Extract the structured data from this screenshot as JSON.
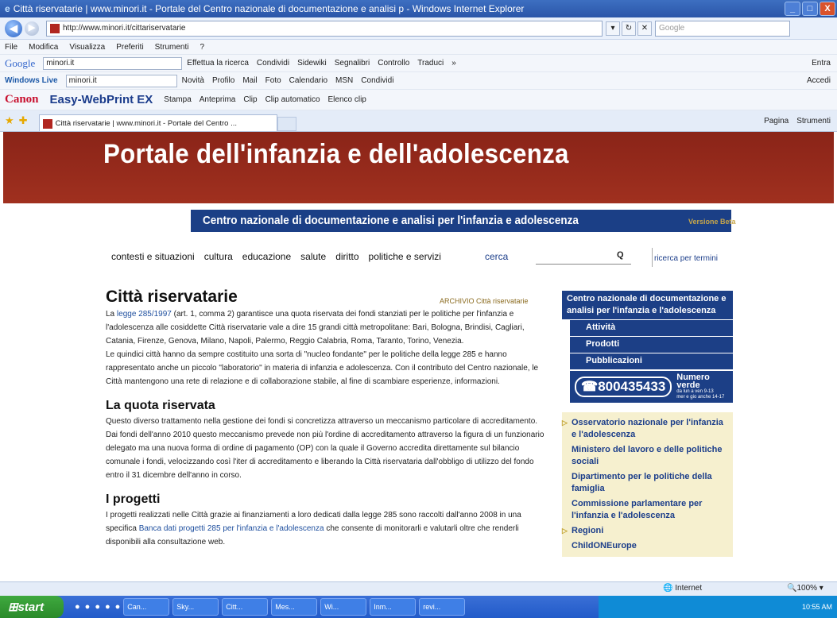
{
  "window": {
    "title": "Città riservatarie | www.minori.it - Portale del Centro nazionale di documentazione e analisi p - Windows Internet Explorer",
    "min": "_",
    "max": "□",
    "close": "X"
  },
  "address": {
    "url": "http://www.minori.it/cittariservatarie",
    "search_placeholder": "Google"
  },
  "menu": [
    "File",
    "Modifica",
    "Visualizza",
    "Preferiti",
    "Strumenti",
    "?"
  ],
  "google_bar": {
    "logo": "Google",
    "query": "minori.it",
    "items": [
      "Effettua la ricerca",
      "Condividi",
      "Sidewiki",
      "Segnalibri",
      "Controllo",
      "Traduci",
      "»"
    ],
    "right": "Entra"
  },
  "live_bar": {
    "logo": "Windows Live",
    "query": "minori.it",
    "items": [
      "Novità",
      "Profilo",
      "Mail",
      "Foto",
      "Calendario",
      "MSN",
      "Condividi"
    ],
    "right": "Accedi"
  },
  "canon_bar": {
    "logo": "Canon",
    "product": "Easy-WebPrint EX",
    "items": [
      "Stampa",
      "Anteprima",
      "Clip",
      "Clip automatico",
      "Elenco clip"
    ]
  },
  "tabs": {
    "active": "Città riservatarie | www.minori.it - Portale del Centro ...",
    "right": [
      "Pagina",
      "Strumenti"
    ]
  },
  "site": {
    "title": "Portale dell'infanzia e dell'adolescenza",
    "subtitle": "Centro nazionale di documentazione e analisi per l'infanzia e adolescenza",
    "version": "Versione Beta",
    "nav": [
      "contesti e situazioni",
      "cultura",
      "educazione",
      "salute",
      "diritto",
      "politiche e servizi"
    ],
    "search_label": "cerca",
    "search_terms": "ricerca per termini"
  },
  "article": {
    "title": "Città riservatarie",
    "archive": "ARCHIVIO Città riservatarie",
    "intro_link": "legge 285/1997",
    "intro_p1": " (art. 1, comma 2) garantisce una quota riservata dei fondi stanziati per le politiche per l'infanzia e l'adolescenza alle cosiddette Città riservatarie vale a dire 15 grandi città metropolitane: Bari, Bologna, Brindisi, Cagliari, Catania, Firenze, Genova, Milano, Napoli, Palermo, Reggio Calabria, Roma, Taranto, Torino, Venezia.",
    "intro_prefix": "La ",
    "intro_p2": "Le quindici città hanno da sempre costituito una sorta di \"nucleo fondante\" per le politiche della legge 285 e hanno rappresentato anche un piccolo \"laboratorio\" in materia di infanzia e adolescenza. Con il contributo del Centro nazionale, le Città mantengono una rete di relazione e di collaborazione stabile, al fine di scambiare esperienze, informazioni.",
    "h2_quota": "La quota riservata",
    "quota_text": "Questo diverso trattamento nella gestione dei fondi si concretizza attraverso un meccanismo particolare di accreditamento. Dai fondi dell'anno 2010 questo meccanismo prevede non più l'ordine di accreditamento attraverso la figura di un funzionario delegato ma una nuova forma di ordine di pagamento (OP) con la quale il Governo accredita direttamente sul bilancio comunale i fondi, velocizzando così l'iter di accreditamento e liberando la Città riservataria dall'obbligo di utilizzo del fondo entro il 31 dicembre dell'anno in corso.",
    "h2_progetti": "I progetti",
    "progetti_pre": "I progetti realizzati nelle Città grazie ai finanziamenti a loro dedicati dalla legge 285 sono raccolti dall'anno 2008 in una specifica ",
    "progetti_link": "Banca dati progetti 285 per l'infanzia e l'adolescenza",
    "progetti_post": " che consente di monitorarli e valutarli oltre che renderli disponibili alla consultazione web."
  },
  "sidebar": {
    "head": "Centro nazionale di documentazione e analisi per l'infanzia e l'adolescenza",
    "subs": [
      "Attività",
      "Prodotti",
      "Pubblicazioni"
    ],
    "phone": "800435433",
    "phone_label": "Numero verde",
    "phone_hours": "da lun a ven 9-13",
    "phone_hours2": "mer e gio anche 14-17",
    "links": [
      "Osservatorio nazionale per l'infanzia e l'adolescenza",
      "Ministero del lavoro e delle politiche sociali",
      "Dipartimento per le politiche della famiglia",
      "Commissione parlamentare per l'infanzia e l'adolescenza",
      "Regioni",
      "ChildONEurope"
    ]
  },
  "status": {
    "zone": "Internet",
    "zoom": "100%"
  },
  "taskbar": {
    "start": "start",
    "buttons": [
      "Can...",
      "Sky...",
      "Citt...",
      "Mes...",
      "Wi...",
      "Inm...",
      "revi..."
    ],
    "clock": "10:55 AM"
  }
}
